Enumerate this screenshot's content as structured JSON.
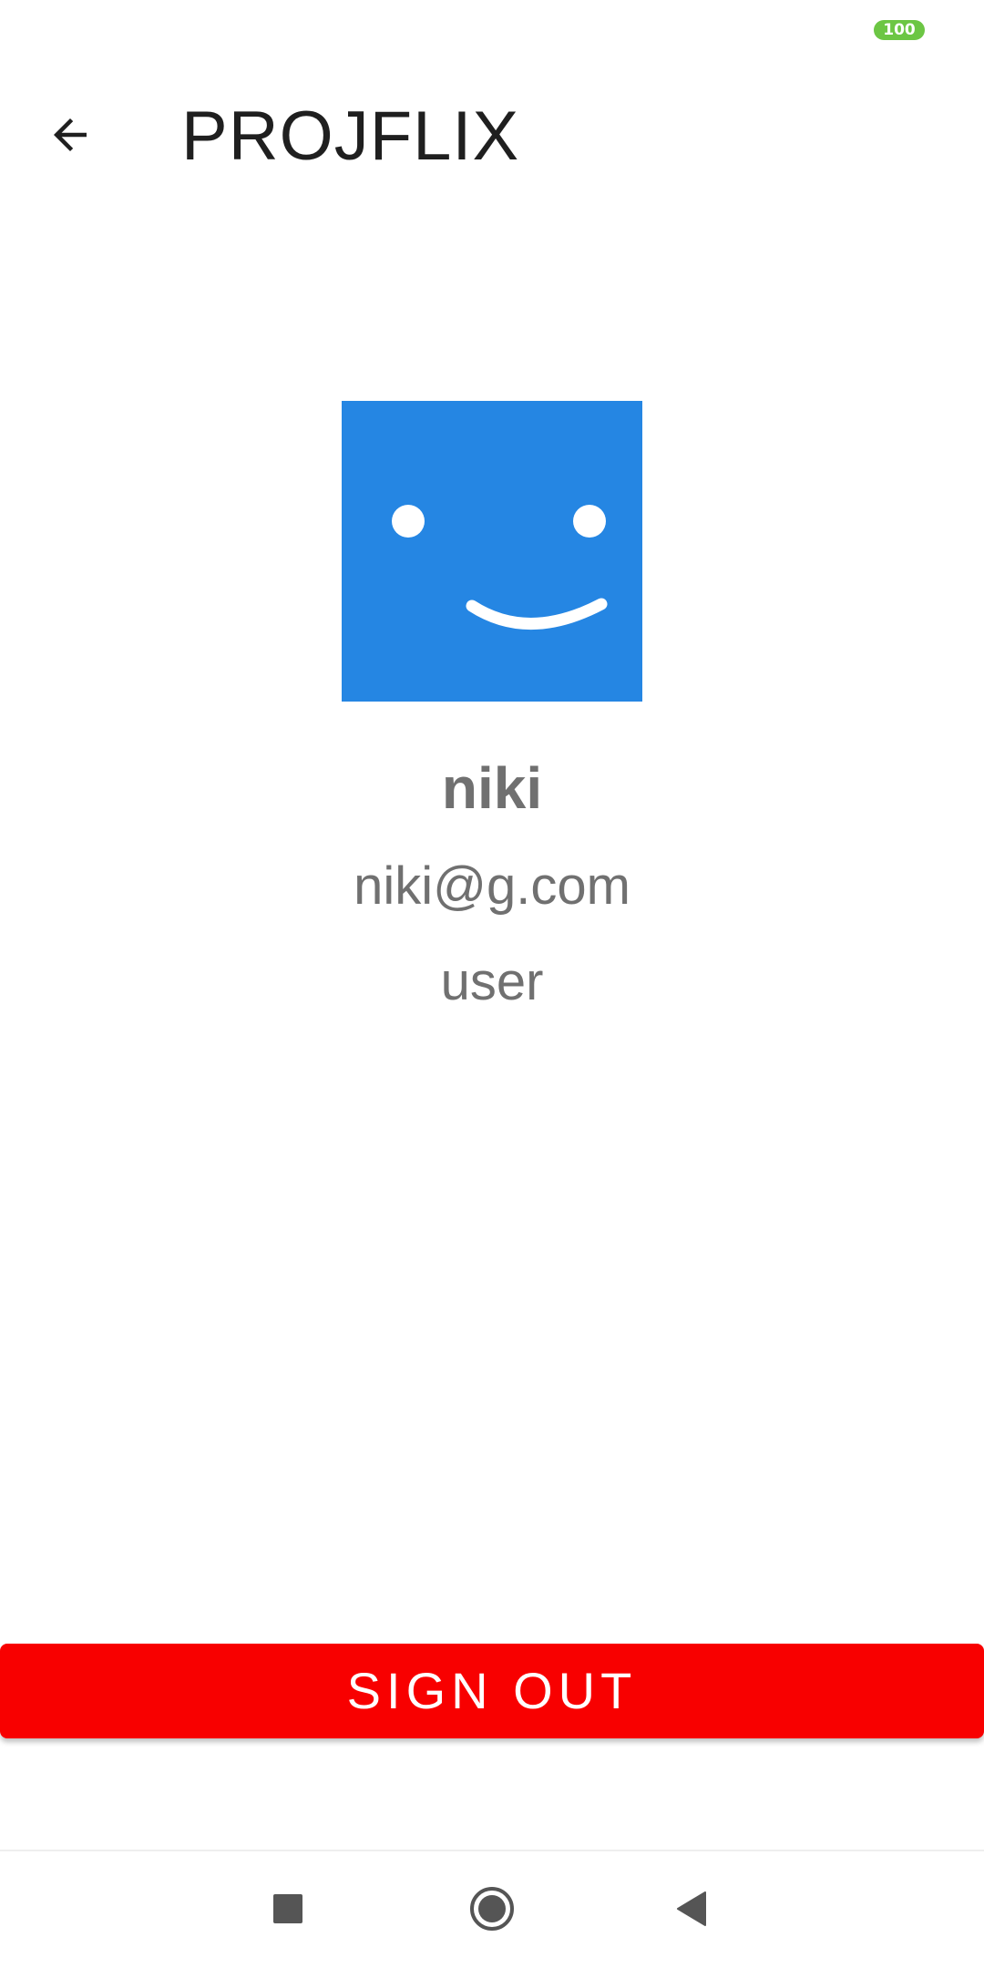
{
  "status_bar": {
    "battery_level": "100",
    "battery_color": "#6cc644"
  },
  "app_bar": {
    "back_icon": "arrow-left-icon",
    "title": "PROJFLIX"
  },
  "profile": {
    "avatar_icon": "smiley-face-icon",
    "avatar_color": "#2586e3",
    "name": "niki",
    "email": "niki@g.com",
    "role": "user"
  },
  "actions": {
    "sign_out_label": "SIGN OUT",
    "sign_out_color": "#f80000"
  },
  "nav_bar": {
    "recents_icon": "square-recents-icon",
    "home_icon": "circle-home-icon",
    "back_icon": "triangle-back-icon"
  }
}
